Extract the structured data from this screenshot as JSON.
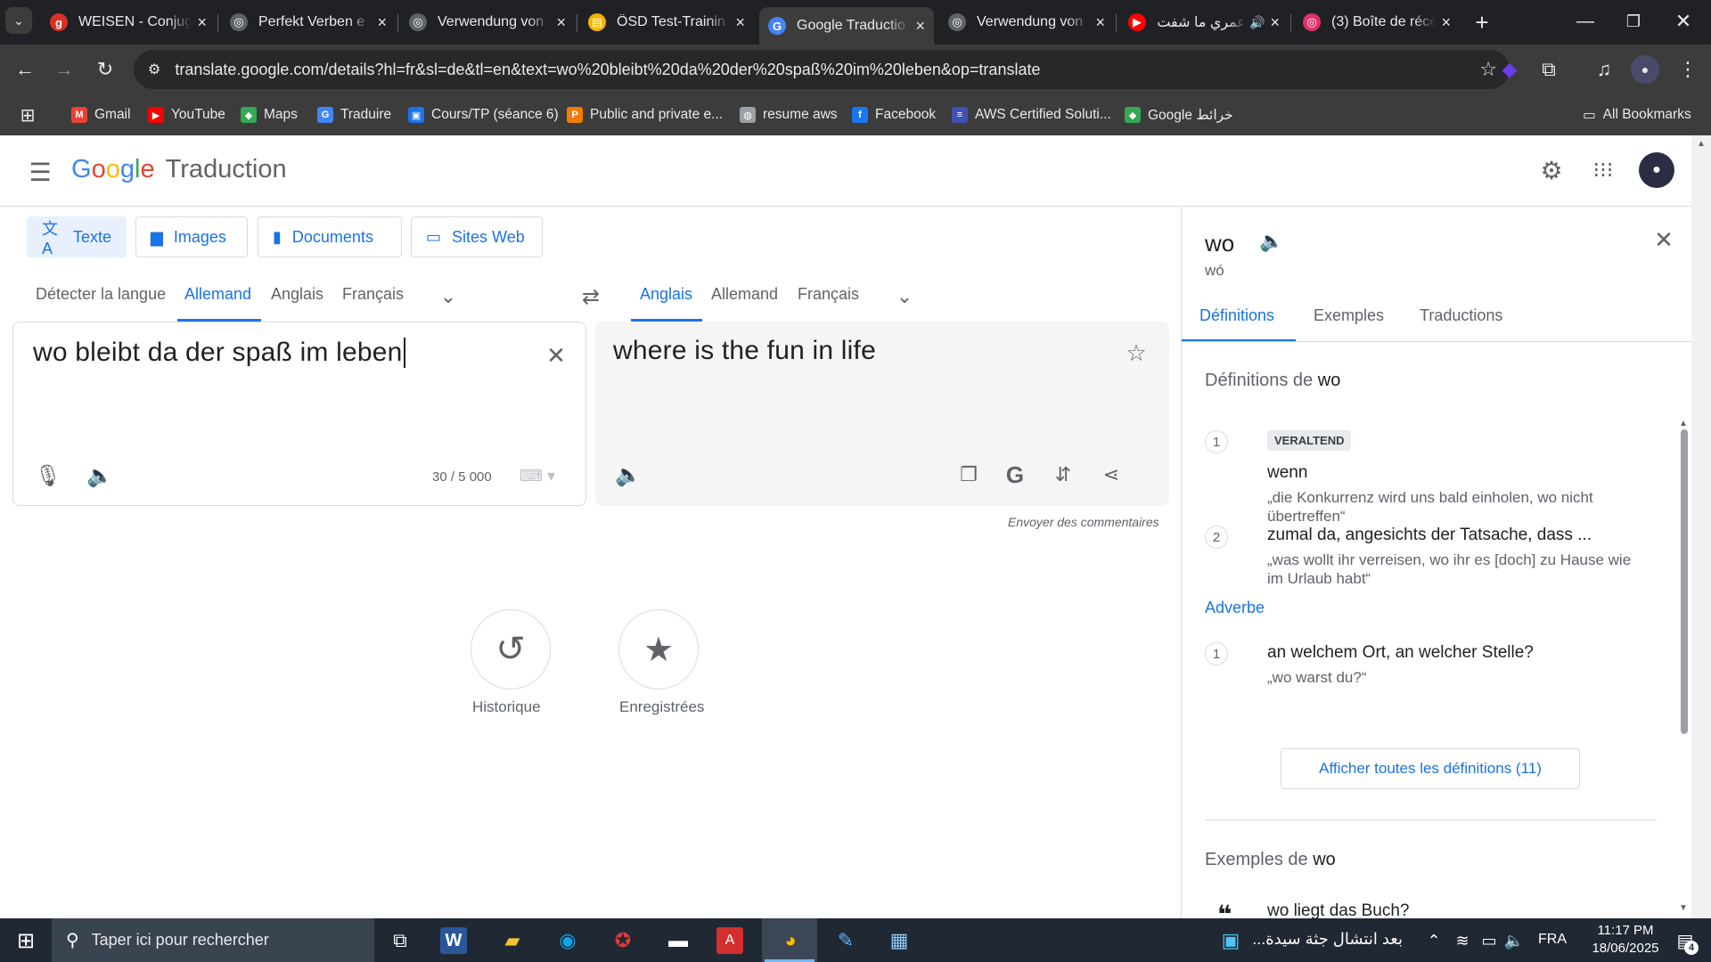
{
  "browser": {
    "tabs": [
      {
        "title": "WEISEN - Conjug",
        "icon": "weisen-favicon",
        "color": "#d93025",
        "glyph": "g"
      },
      {
        "title": "Perfekt Verben e",
        "icon": "openai-favicon",
        "color": "#5f6368",
        "glyph": "◎"
      },
      {
        "title": "Verwendung von",
        "icon": "openai-favicon",
        "color": "#5f6368",
        "glyph": "◎"
      },
      {
        "title": "ÖSD Test-Trainin",
        "icon": "osd-favicon",
        "color": "#f4b400",
        "glyph": "▤"
      },
      {
        "title": "Google Traductio",
        "icon": "google-translate-favicon",
        "color": "#4285f4",
        "glyph": "G"
      },
      {
        "title": "Verwendung von",
        "icon": "openai-favicon",
        "color": "#5f6368",
        "glyph": "◎"
      },
      {
        "title": "عمري ما شفت",
        "icon": "youtube-favicon",
        "color": "#ff0000",
        "glyph": "▶"
      },
      {
        "title": "(3) Boîte de réce",
        "icon": "instagram-favicon",
        "color": "#e1306c",
        "glyph": "◎"
      }
    ],
    "url": "translate.google.com/details?hl=fr&sl=de&tl=en&text=wo%20bleibt%20da%20der%20spaß%20im%20leben&op=translate",
    "bookmarks": [
      {
        "label": "Gmail",
        "color": "#ea4335",
        "glyph": "M"
      },
      {
        "label": "YouTube",
        "color": "#ff0000",
        "glyph": "▶"
      },
      {
        "label": "Maps",
        "color": "#34a853",
        "glyph": "◆"
      },
      {
        "label": "Traduire",
        "color": "#4285f4",
        "glyph": "G"
      },
      {
        "label": "Cours/TP (séance 6)",
        "color": "#1a73e8",
        "glyph": "▣"
      },
      {
        "label": "Public and private e...",
        "color": "#f57c00",
        "glyph": "P"
      },
      {
        "label": "resume aws",
        "color": "#9aa0a6",
        "glyph": "◍"
      },
      {
        "label": "Facebook",
        "color": "#1877f2",
        "glyph": "f"
      },
      {
        "label": "AWS Certified Soluti...",
        "color": "#3f51b5",
        "glyph": "≡"
      },
      {
        "label": "Google خرائط",
        "color": "#34a853",
        "glyph": "◆"
      }
    ],
    "all_bookmarks": "All Bookmarks"
  },
  "app": {
    "brand_google": "Google",
    "brand_product": "Traduction",
    "modes": [
      "Texte",
      "Images",
      "Documents",
      "Sites Web"
    ],
    "source_langs": [
      "Détecter la langue",
      "Allemand",
      "Anglais",
      "Français"
    ],
    "target_langs": [
      "Anglais",
      "Allemand",
      "Français"
    ],
    "source_text": "wo bleibt da der spaß im leben",
    "char_count": "30 / 5 000",
    "translation": "where is the fun in life",
    "feedback": "Envoyer des commentaires",
    "history_label": "Historique",
    "saved_label": "Enregistrées"
  },
  "side": {
    "word": "wo",
    "phonetic": "wó",
    "tabs": [
      "Définitions",
      "Exemples",
      "Traductions"
    ],
    "def_heading_prefix": "Définitions de",
    "def_heading_word": "wo",
    "defs": [
      {
        "num": "1",
        "tag": "VERALTEND",
        "text": "wenn",
        "example": "„die Konkurrenz wird uns bald einholen, wo nicht übertreffen“"
      },
      {
        "num": "2",
        "text": "zumal da, angesichts der Tatsache, dass ...",
        "example": "„was wollt ihr verreisen, wo ihr es [doch] zu Hause wie im Urlaub habt“"
      }
    ],
    "pos": "Adverbe",
    "adv_def": {
      "num": "1",
      "text": "an welchem Ort, an welcher Stelle?",
      "example": "„wo warst du?“"
    },
    "show_all": "Afficher toutes les définitions (11)",
    "examples_heading_prefix": "Exemples de",
    "examples_heading_word": "wo",
    "first_example": "wo liegt das Buch?"
  },
  "taskbar": {
    "search_placeholder": "Taper ici pour rechercher",
    "news": "بعد انتشال جثة سيدة...",
    "lang": "FRA",
    "time": "11:17 PM",
    "date": "18/06/2025",
    "notif_count": "4"
  }
}
